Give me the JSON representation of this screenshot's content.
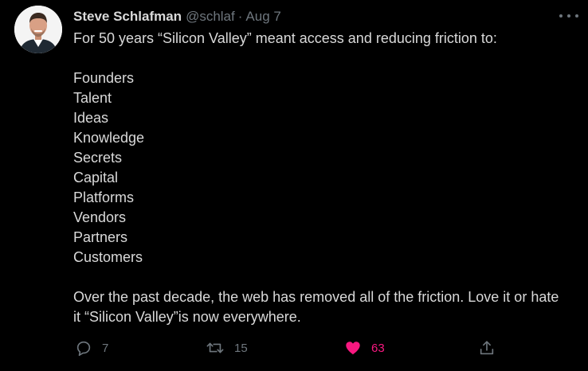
{
  "tweet": {
    "author_name": "Steve Schlafman",
    "handle": "@schlaf",
    "separator": "·",
    "date": "Aug 7",
    "intro": "For 50 years “Silicon Valley” meant access and reducing friction to:",
    "list": [
      "Founders",
      "Talent",
      "Ideas",
      "Knowledge",
      "Secrets",
      "Capital",
      "Platforms",
      "Vendors",
      "Partners",
      "Customers"
    ],
    "closing_line1": "Over the past decade, the web has removed all of the friction. Love it or hate",
    "closing_line2": "it “Silicon Valley”is now everywhere."
  },
  "actions": {
    "replies": "7",
    "retweets": "15",
    "likes": "63",
    "liked": true
  },
  "icons": {
    "more": "more-horizontal-icon",
    "reply": "reply-bubble-icon",
    "retweet": "retweet-icon",
    "like": "heart-icon",
    "share": "share-icon"
  },
  "colors": {
    "background": "#000000",
    "text": "#d9d9d9",
    "muted": "#6e767d",
    "like": "#f91880"
  }
}
